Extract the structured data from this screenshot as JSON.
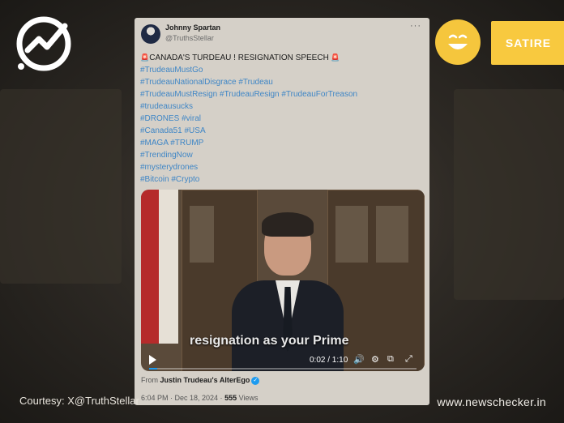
{
  "branding": {
    "logo_icon": "newschecker-check-logo",
    "badge_icon": "smiley-face-icon",
    "rating_label": "SATIRE",
    "accent_color": "#f8c93f"
  },
  "tweet": {
    "author_name": "Johnny Spartan",
    "author_handle": "@TruthsStellar",
    "more_icon": "more-options-icon",
    "headline": "CANADA'S TURDEAU ! RESIGNATION SPEECH",
    "hashtags": [
      "#TrudeauMustGo",
      "#TrudeauNationalDisgrace #Trudeau",
      "#TrudeauMustResign #TrudeauResign #TrudeauForTreason",
      "#trudeausucks",
      "#DRONES #viral",
      "#Canada51 #USA",
      "#MAGA #TRUMP",
      "#TrendingNow",
      "#mysterydrones",
      "#Bitcoin #Crypto"
    ],
    "video": {
      "subtitle": "resignation as your Prime",
      "time": "0:02 / 1:10",
      "progress": 0.03
    },
    "from_prefix": "From",
    "from_account": "Justin Trudeau's AlterEgo",
    "timestamp": "6:04 PM · Dec 18, 2024 ·",
    "views_count": "555",
    "views_label": "Views"
  },
  "footer": {
    "courtesy": "Courtesy: X@TruthStellar",
    "website": "www.newschecker.in"
  }
}
